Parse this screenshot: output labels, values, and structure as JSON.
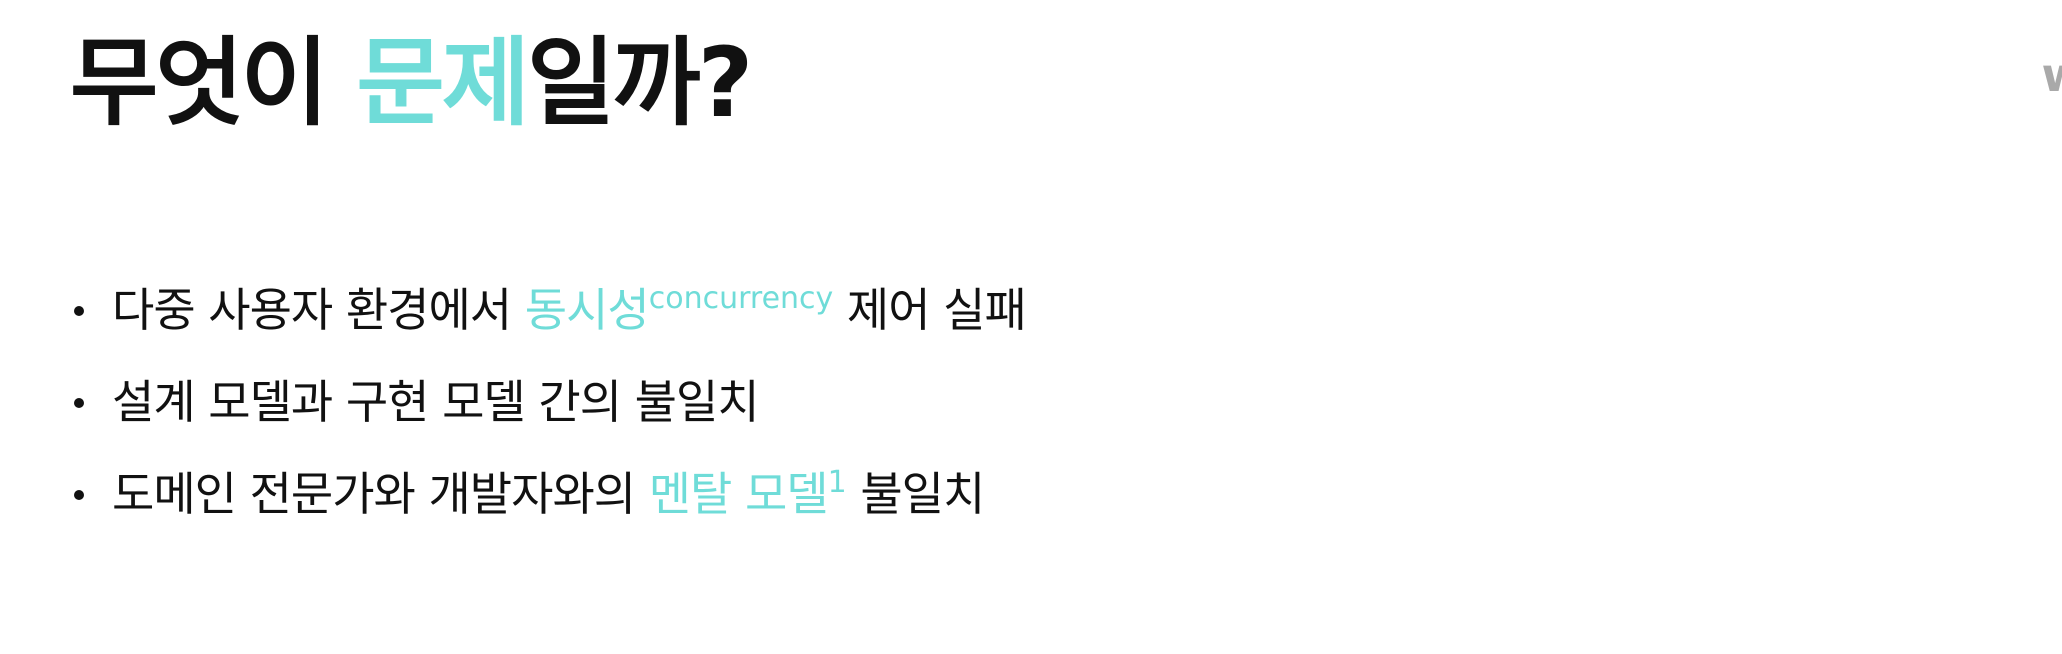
{
  "title": {
    "prefix": "무엇이 ",
    "highlight": "문제",
    "suffix": "일까?"
  },
  "corner_mark": "w",
  "bullets": [
    {
      "before": "다중 사용자 환경에서 ",
      "highlight": "동시성",
      "sup": "concurrency",
      "after": " 제어 실패"
    },
    {
      "text": "설계 모델과 구현 모델 간의 불일치"
    },
    {
      "before": "도메인 전문가와 개발자와의 ",
      "highlight": "멘탈 모델",
      "sup": "1",
      "after": " 불일치"
    }
  ],
  "colors": {
    "accent": "#6fdcd8",
    "text": "#111111",
    "corner_mark": "#a9a9a9",
    "background": "#ffffff"
  }
}
